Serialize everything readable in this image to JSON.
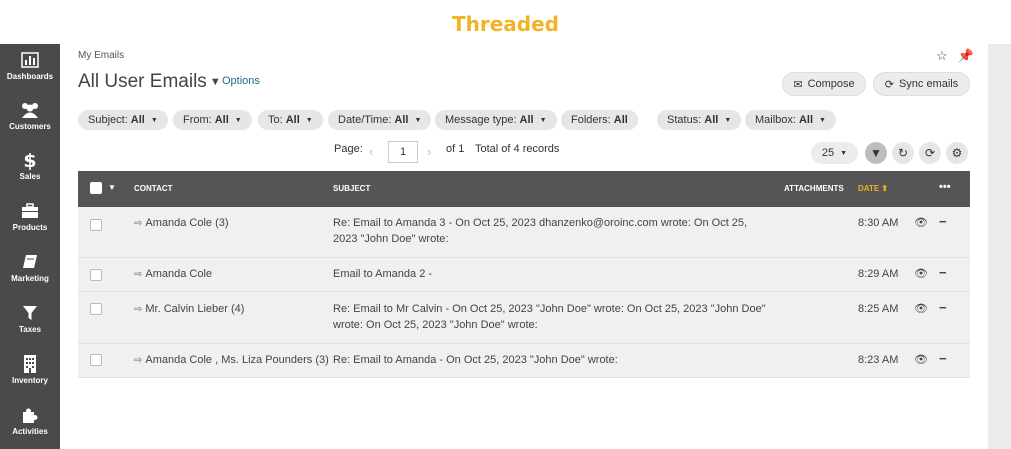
{
  "header": {
    "title": "Threaded"
  },
  "sidebar": {
    "items": [
      {
        "label": "Dashboards",
        "icon": "bar-chart-icon"
      },
      {
        "label": "Customers",
        "icon": "users-icon"
      },
      {
        "label": "Sales",
        "icon": "dollar-icon"
      },
      {
        "label": "Products",
        "icon": "briefcase-icon"
      },
      {
        "label": "Marketing",
        "icon": "book-icon"
      },
      {
        "label": "Taxes",
        "icon": "filter-icon"
      },
      {
        "label": "Inventory",
        "icon": "building-icon"
      },
      {
        "label": "Activities",
        "icon": "puzzle-icon"
      }
    ]
  },
  "page": {
    "breadcrumb": "My Emails",
    "title": "All User Emails",
    "options_label": "Options"
  },
  "actions": {
    "compose": "Compose",
    "sync": "Sync emails"
  },
  "filters": [
    {
      "label": "Subject:",
      "value": "All"
    },
    {
      "label": "From:",
      "value": "All"
    },
    {
      "label": "To:",
      "value": "All"
    },
    {
      "label": "Date/Time:",
      "value": "All"
    },
    {
      "label": "Message type:",
      "value": "All"
    },
    {
      "label": "Folders:",
      "value": "All"
    },
    {
      "label": "Status:",
      "value": "All"
    },
    {
      "label": "Mailbox:",
      "value": "All"
    }
  ],
  "pager": {
    "page_label": "Page:",
    "current_page": "1",
    "of_label": "of 1",
    "total_label": "Total of 4 records",
    "per_page": "25"
  },
  "grid": {
    "columns": {
      "contact": "CONTACT",
      "subject": "SUBJECT",
      "attachments": "ATTACHMENTS",
      "date": "DATE"
    },
    "rows": [
      {
        "contact": "Amanda Cole (3)",
        "subject": "Re: Email to Amanda 3 - On Oct 25, 2023 dhanzenko@oroinc.com wrote: On Oct 25, 2023 \"John Doe\" wrote:",
        "time": "8:30 AM"
      },
      {
        "contact": "Amanda Cole",
        "subject": "Email to Amanda 2 -",
        "time": "8:29 AM"
      },
      {
        "contact": "Mr. Calvin Lieber (4)",
        "subject": "Re: Email to Mr Calvin - On Oct 25, 2023 \"John Doe\" wrote: On Oct 25, 2023 \"John Doe\" wrote: On Oct 25, 2023 \"John Doe\" wrote:",
        "time": "8:25 AM"
      },
      {
        "contact": "Amanda Cole , Ms. Liza Pounders (3)",
        "subject": "Re: Email to Amanda - On Oct 25, 2023 \"John Doe\" wrote:",
        "time": "8:23 AM"
      }
    ]
  },
  "colors": {
    "accent": "#f0b323",
    "sidebar": "#4a4a4a",
    "grid_header": "#555555",
    "link": "#1e6b8f"
  }
}
